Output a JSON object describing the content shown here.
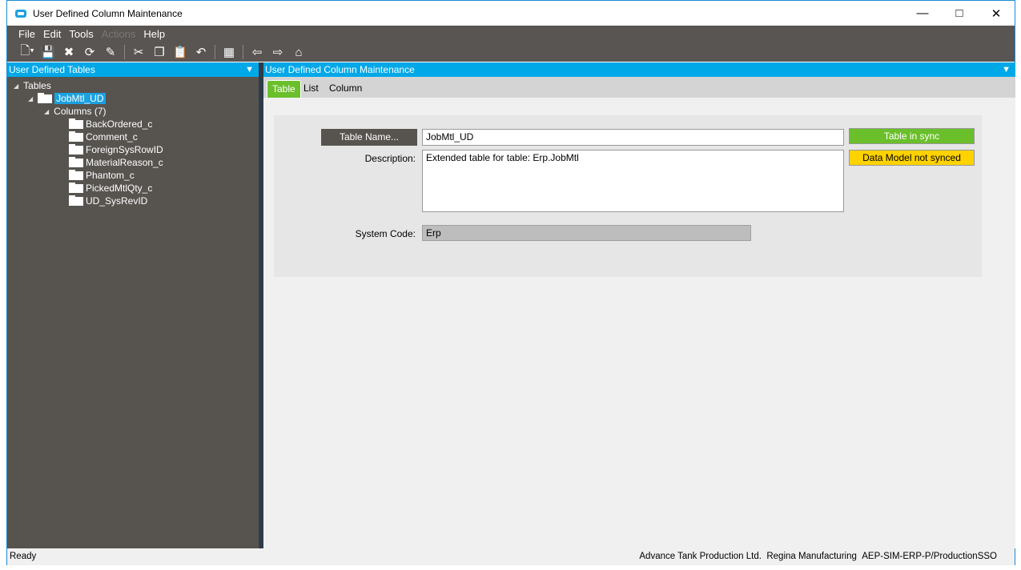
{
  "window": {
    "title": "User Defined Column Maintenance",
    "controls": [
      "minimize",
      "maximize",
      "close"
    ]
  },
  "menu": [
    {
      "label": "File",
      "enabled": true
    },
    {
      "label": "Edit",
      "enabled": true
    },
    {
      "label": "Tools",
      "enabled": true
    },
    {
      "label": "Actions",
      "enabled": false
    },
    {
      "label": "Help",
      "enabled": true
    }
  ],
  "left_panel": {
    "title": "User Defined Tables",
    "tree": {
      "root": "Tables",
      "table": "JobMtl_UD",
      "columns_label": "Columns (7)",
      "columns": [
        "BackOrdered_c",
        "Comment_c",
        "ForeignSysRowID",
        "MaterialReason_c",
        "Phantom_c",
        "PickedMtlQty_c",
        "UD_SysRevID"
      ]
    }
  },
  "right_panel": {
    "title": "User Defined Column Maintenance",
    "tabs": [
      "Table",
      "List",
      "Column"
    ],
    "active_tab": "Table"
  },
  "form": {
    "table_name_button": "Table Name...",
    "table_name": "JobMtl_UD",
    "description_label": "Description:",
    "description": "Extended table for table: Erp.JobMtl",
    "system_code_label": "System Code:",
    "system_code": "Erp",
    "sync_status": "Table in sync",
    "model_status": "Data Model not synced"
  },
  "colors": {
    "accent": "#00a8e8",
    "sync": "#6abf2a",
    "warn": "#ffd200"
  },
  "status": {
    "left": "Ready",
    "company": "Advance Tank Production Ltd.",
    "site": "Regina Manufacturing",
    "server": "AEP-SIM-ERP-P/ProductionSSO"
  }
}
